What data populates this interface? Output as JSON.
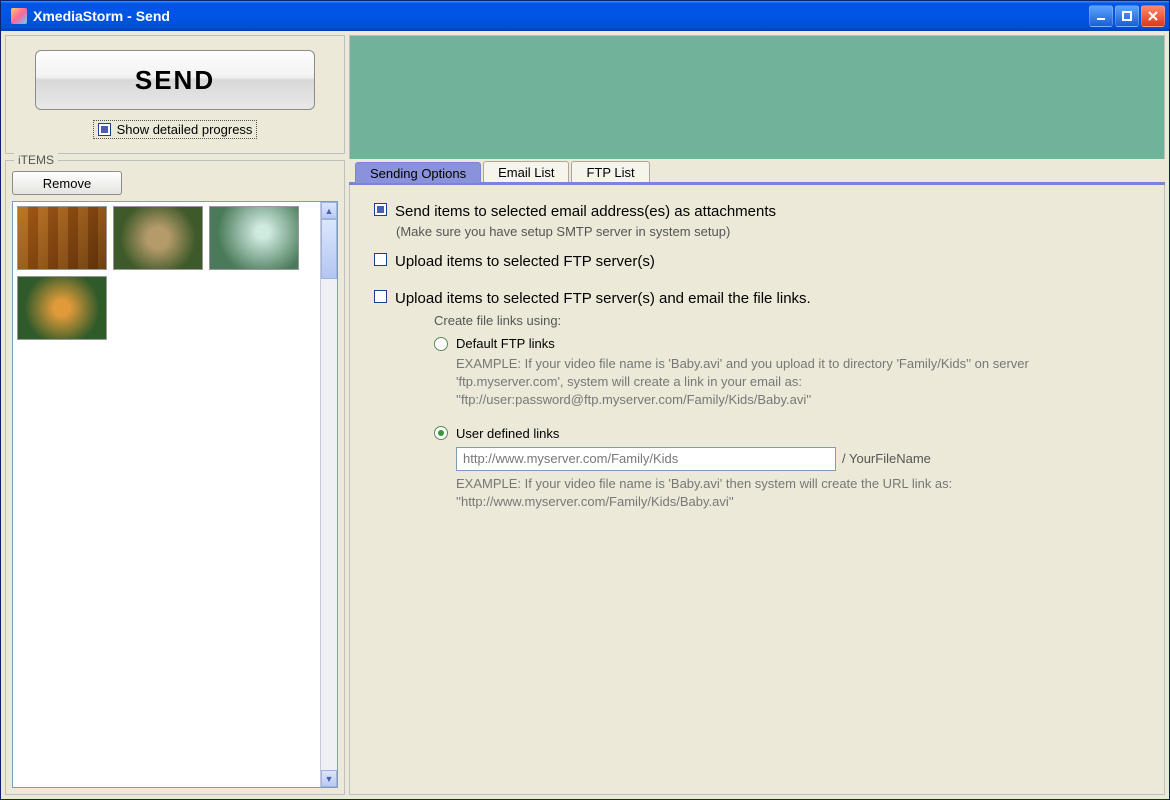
{
  "window": {
    "title": "XmediaStorm - Send"
  },
  "sidebar": {
    "send_label": "SEND",
    "show_progress_label": "Show detailed progress",
    "items_group_label": "iTEMS",
    "remove_label": "Remove"
  },
  "tabs": {
    "sending_options": "Sending Options",
    "email_list": "Email List",
    "ftp_list": "FTP List"
  },
  "options": {
    "email_attach": "Send items to selected email address(es) as attachments",
    "email_attach_note": "(Make sure you have setup SMTP server in system setup)",
    "ftp_upload": "Upload items to selected FTP server(s)",
    "ftp_upload_email": "Upload items to selected FTP server(s) and email the file links.",
    "create_links_label": "Create file links using:",
    "default_ftp_links": "Default FTP links",
    "default_example": "EXAMPLE: If your video file name is 'Baby.avi' and you upload it to directory 'Family/Kids'' on server 'ftp.myserver.com', system will create a link in your email as: ''ftp://user:password@ftp.myserver.com/Family/Kids/Baby.avi''",
    "user_defined_links": "User defined links",
    "url_value": "http://www.myserver.com/Family/Kids",
    "url_suffix": "/ YourFileName",
    "user_example": "EXAMPLE: If your video file name is 'Baby.avi' then system will create the URL link as: ''http://www.myserver.com/Family/Kids/Baby.avi''"
  }
}
